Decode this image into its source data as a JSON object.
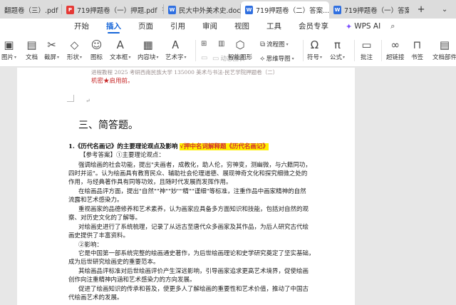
{
  "tabs": [
    {
      "label": "翻题卷（三）.pdf",
      "type": "pdf",
      "active": false
    },
    {
      "label": "719押题卷（一）押题.pdf",
      "type": "pdf",
      "active": false
    },
    {
      "label": "民大中外美术史.docx",
      "type": "word",
      "active": false
    },
    {
      "label": "719押题卷（二）答案...",
      "type": "word",
      "active": true
    },
    {
      "label": "719押题卷（一）答案...",
      "type": "word",
      "active": false
    }
  ],
  "tab_tools": {
    "new": "+",
    "more": "⌄"
  },
  "menu": [
    "开始",
    "插入",
    "页面",
    "引用",
    "审阅",
    "视图",
    "工具",
    "会员专享"
  ],
  "menu_active": "插入",
  "wps_ai": "WPS AI",
  "ribbon": {
    "picture": "图片",
    "document": "文档",
    "screenshot": "截屏",
    "shape": "形状",
    "icon": "图标",
    "textbox": "文本框",
    "library": "内容块",
    "art": "艺术字",
    "small1": "",
    "small2": "",
    "small3": "",
    "small4": "动态图表",
    "smart": "智能图形",
    "flowchart": "流程图",
    "mindmap": "思维导图",
    "symbol": "符号",
    "formula": "公式",
    "comment": "批注",
    "hyperlink": "超链接",
    "bookmark": "书签",
    "docparts": "文档部件"
  },
  "doc": {
    "faint_top": "进程教程 2025 考研西南民族大学 135000 美术与书法-民艺学院押题卷（二）",
    "red_line": "机密★启用前。",
    "section_heading": "三、简答题。",
    "q_label": "1.《历代名画记》的主要理论观点及影响",
    "q_highlight": "√押中名词解释题《历代名画记》",
    "lines": [
      "【参考答案】①主要理论观点：",
      "强调绘画的社会功能，提出\"夫画者，成教化，助人伦，穷神变，测幽微，与六籍同功，",
      "四时并运\"。认为绘画具有教育民众、辅助社会伦理道德、展现神奇文化和探究细微之处的",
      "作用，与经典著作具有同等功效，且随时代发展而发挥作用。",
      "在绘画品评方面，提出\"自然\"\"神\"\"妙\"\"精\"\"谨细\"等标准，注重作品中画家精神的自然",
      "流露和艺术感染力。",
      "重视画家的品德修养和艺术素养，认为画家应具备多方面知识和技能，包括对自然的观",
      "察、对历史文化的了解等。",
      "对绘画史进行了系统梳理，记录了从远古至唐代众多画家及其作品，为后人研究古代绘",
      "画史提供了丰富资料。",
      "②影响：",
      "它是中国第一部系统完整的绘画通史著作，为后世绘画理论和史学研究奠定了坚实基础，",
      "成为后世研究绘画史的重要范本。",
      "其绘画品评标准对后世绘画评价产生深远影响，引导画家追求更高艺术境界，促使绘画",
      "创作向注重精神内涵和艺术感染力的方向发展。",
      "促进了绘画知识的传承和普及，使更多人了解绘画的重要性和艺术价值，推动了中国古",
      "代绘画艺术的发展。"
    ]
  },
  "colors": {
    "accent": "#1565d8",
    "highlight": "#fff000",
    "red_text": "#d32f2f",
    "pdf_icon": "#e53935",
    "word_icon": "#2f6fe0"
  }
}
